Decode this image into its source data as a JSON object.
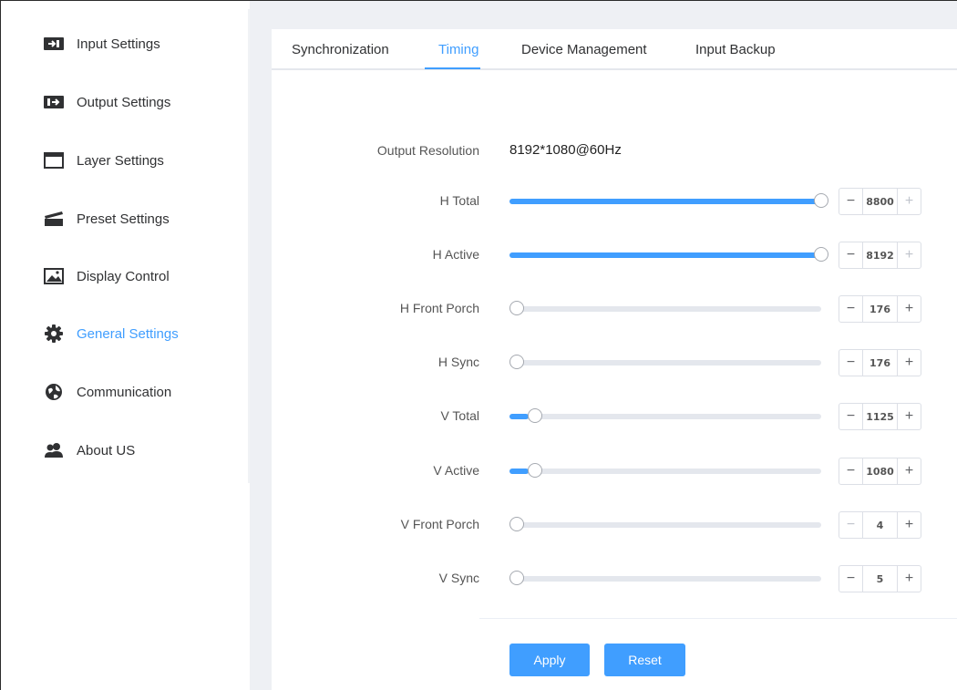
{
  "sidebar": {
    "items": [
      {
        "label": "Input Settings",
        "icon": "input-icon"
      },
      {
        "label": "Output Settings",
        "icon": "output-icon"
      },
      {
        "label": "Layer Settings",
        "icon": "layer-window-icon"
      },
      {
        "label": "Preset Settings",
        "icon": "clapperboard-icon"
      },
      {
        "label": "Display Control",
        "icon": "image-icon"
      },
      {
        "label": "General Settings",
        "icon": "gear-icon"
      },
      {
        "label": "Communication",
        "icon": "globe-icon"
      },
      {
        "label": "About US",
        "icon": "users-icon"
      }
    ],
    "active_index": 5
  },
  "tabs": [
    {
      "label": "Synchronization"
    },
    {
      "label": "Timing"
    },
    {
      "label": "Device Management"
    },
    {
      "label": "Input Backup"
    }
  ],
  "active_tab": "Timing",
  "output_resolution": {
    "label": "Output Resolution",
    "value": "8192*1080@60Hz"
  },
  "params": [
    {
      "label": "H Total",
      "value": "8800",
      "slider_fraction": 1.0,
      "minus_disabled": false,
      "plus_disabled": true
    },
    {
      "label": "H Active",
      "value": "8192",
      "slider_fraction": 1.0,
      "minus_disabled": false,
      "plus_disabled": true
    },
    {
      "label": "H Front Porch",
      "value": "176",
      "slider_fraction": 0.0,
      "minus_disabled": false,
      "plus_disabled": false
    },
    {
      "label": "H Sync",
      "value": "176",
      "slider_fraction": 0.0,
      "minus_disabled": false,
      "plus_disabled": false
    },
    {
      "label": "V Total",
      "value": "1125",
      "slider_fraction": 0.06,
      "minus_disabled": false,
      "plus_disabled": false
    },
    {
      "label": "V Active",
      "value": "1080",
      "slider_fraction": 0.06,
      "minus_disabled": false,
      "plus_disabled": false
    },
    {
      "label": "V Front Porch",
      "value": "4",
      "slider_fraction": 0.0,
      "minus_disabled": true,
      "plus_disabled": false
    },
    {
      "label": "V Sync",
      "value": "5",
      "slider_fraction": 0.0,
      "minus_disabled": false,
      "plus_disabled": false
    }
  ],
  "buttons": {
    "apply": "Apply",
    "reset": "Reset"
  },
  "colors": {
    "accent": "#409eff",
    "track": "#e4e7ed",
    "panel_bg": "#eef0f4"
  }
}
